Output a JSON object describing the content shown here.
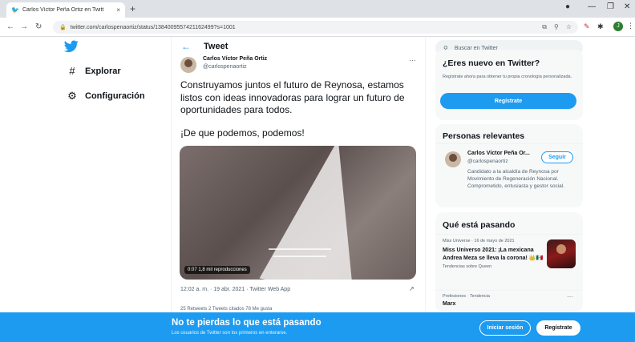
{
  "browser": {
    "tab_title": "Carlos Víctor Peña Ortiz en Twitt",
    "tab_close": "×",
    "new_tab": "+",
    "url": "twitter.com/carlospenaortiz/status/1384009557421162499?s=1001",
    "profile_initial": "J"
  },
  "sidebar": {
    "items": [
      {
        "label": "Explorar",
        "icon": "#"
      },
      {
        "label": "Configuración",
        "icon": "⚙"
      }
    ]
  },
  "header": {
    "back": "←",
    "title": "Tweet"
  },
  "tweet": {
    "author_name": "Carlos Víctor Peña Ortiz",
    "author_handle": "@carlospenaortiz",
    "text": "Construyamos juntos el futuro de Reynosa, estamos listos con ideas innovadoras para lograr un futuro de oportunidades para todos.",
    "text2": "¡De que podemos, podemos!",
    "video_badge": "0:07  1,8 mil reproducciones",
    "timestamp": "12:02 a. m. · 19 abr. 2021 · Twitter Web App",
    "stats": "25 Retweets     2 Tweets citados     78 Me gusta"
  },
  "search": {
    "placeholder": "Buscar en Twitter"
  },
  "new_to_twitter": {
    "title": "¿Eres nuevo en Twitter?",
    "description": "Regístrate ahora para obtener tu propia cronología personalizada.",
    "button": "Regístrate"
  },
  "relevant_people": {
    "title": "Personas relevantes",
    "name": "Carlos Víctor Peña Or...",
    "handle": "@carlospenaortiz",
    "follow": "Seguir",
    "bio": "Candidato a la alcaldía de Reynosa por Movimiento de Regeneración Nacional. Comprometido, entusiasta y gestor social."
  },
  "trends": {
    "title": "Qué está pasando",
    "items": [
      {
        "meta": "Miss Universe · 16 de mayo de 2021",
        "headline": "Miss Universo 2021: ¡La mexicana Andrea Meza se lleva la corona! 👑🇲🇽",
        "sub": "Tendencias sobre Queen"
      },
      {
        "meta": "Profesiones · Tendencia",
        "headline": "Marx"
      }
    ]
  },
  "banner": {
    "title": "No te pierdas lo que está pasando",
    "subtitle": "Los usuarios de Twitter son los primeros en enterarse.",
    "login": "Iniciar sesión",
    "signup": "Regístrate"
  }
}
